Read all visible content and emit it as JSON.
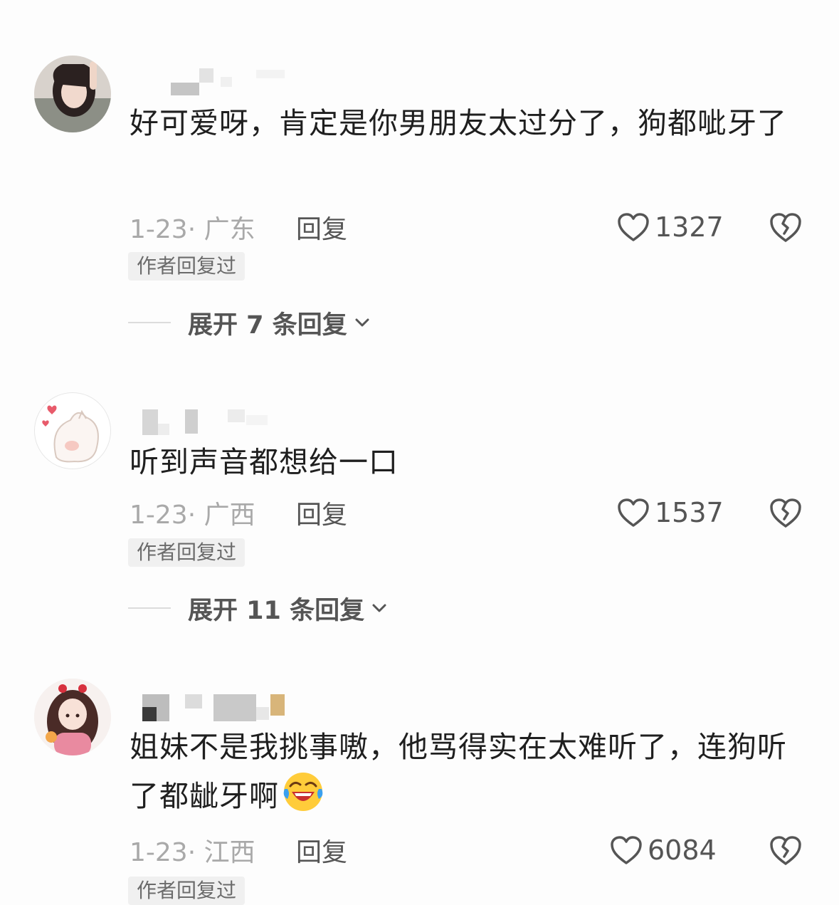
{
  "comments": [
    {
      "text": "好可爱呀，肯定是你男朋友太过分了，狗都呲牙了",
      "date_location": "1-23· 广东",
      "reply_label": "回复",
      "likes": "1327",
      "badge": "作者回复过",
      "expand_label": "展开 7 条回复"
    },
    {
      "text": "听到声音都想给一口",
      "date_location": "1-23· 广西",
      "reply_label": "回复",
      "likes": "1537",
      "badge": "作者回复过",
      "expand_label": "展开 11 条回复"
    },
    {
      "text": "姐妹不是我挑事嗷，他骂得实在太难听了，连狗听了都龇牙啊",
      "emoji": "laughing-crying-emoji",
      "date_location": "1-23· 江西",
      "reply_label": "回复",
      "likes": "6084",
      "badge": "作者回复过"
    }
  ],
  "colors": {
    "text": "#1f1f1f",
    "meta": "#a9a9a9",
    "badge_bg": "#f0f0f0",
    "icon": "#555555"
  },
  "icons": [
    "heart-outline-icon",
    "broken-heart-icon",
    "chevron-down-icon"
  ]
}
